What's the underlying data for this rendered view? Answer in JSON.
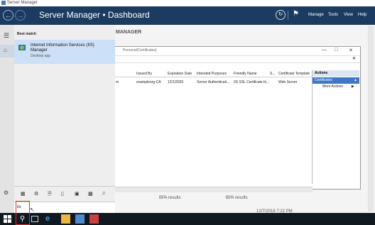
{
  "window": {
    "title": "Server Manager",
    "breadcrumb": "Server Manager • Dashboard",
    "menu": [
      "Manage",
      "Tools",
      "View",
      "Help"
    ],
    "dashboard_label": "MANAGER",
    "bpa_1": "BPA results",
    "bpa_2": "BPA results",
    "timestamp": "12/7/2018 7:22 PM"
  },
  "cert_window": {
    "title": "Personal\\Certificates]",
    "columns": [
      "Issued By",
      "Expiration Date",
      "Intended Purposes",
      "Friendly Name",
      "S...",
      "Certificate Template"
    ],
    "row": [
      "m",
      "exampleorg-CA",
      "12/1/2020",
      "Server Authenticati...",
      "IIS SSL Certificate fo...",
      "Web Server"
    ],
    "actions_header": "Actions",
    "actions_selected": "Certificates",
    "actions_more": "More Actions"
  },
  "start_menu": {
    "best_match_label": "Best match",
    "result_name": "Internet Information Services (IIS) Manager",
    "result_type": "Desktop app",
    "search_value": "iis"
  },
  "colors": {
    "header": "#1b3b61",
    "highlight": "#cce0f7",
    "selected": "#3e78c2"
  },
  "icons": [
    "hamburger-icon",
    "home-icon",
    "settings-icon",
    "windows-icon",
    "search-icon",
    "task-view-icon",
    "edge-icon",
    "file-explorer-icon",
    "server-manager-icon",
    "app-icon"
  ]
}
